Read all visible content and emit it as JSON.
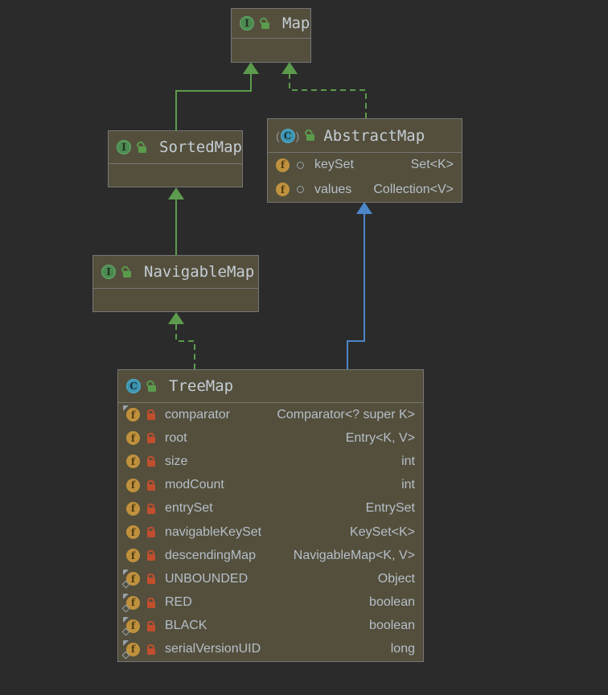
{
  "diagram": {
    "type": "uml-class-diagram",
    "colors": {
      "bg": "#2B2B2B",
      "box_fill": "#544F3C",
      "box_border": "#757575",
      "title": "#C4CDD5",
      "field": "#B5BFC9",
      "green": "#5C9B4D",
      "blue": "#4C87C9",
      "lock_private": "#C14E2E",
      "field_icon": "#C0913D",
      "mark": "#98A2AA"
    },
    "icons": {
      "interface_letter": "I",
      "class_letter": "C",
      "field_letter": "f",
      "abstract_paren_open": "(",
      "abstract_paren_close": ")"
    }
  },
  "classes": {
    "map": {
      "name": "Map",
      "kind": "interface",
      "visibility": "public",
      "fields": []
    },
    "sortedmap": {
      "name": "SortedMap",
      "kind": "interface",
      "visibility": "public",
      "fields": []
    },
    "abstractmap": {
      "name": "AbstractMap",
      "kind": "abstract-class",
      "visibility": "public",
      "fields": [
        {
          "name": "keySet",
          "type": "Set<K>",
          "visibility": "package"
        },
        {
          "name": "values",
          "type": "Collection<V>",
          "visibility": "package"
        }
      ]
    },
    "navigablemap": {
      "name": "NavigableMap",
      "kind": "interface",
      "visibility": "public",
      "fields": []
    },
    "treemap": {
      "name": "TreeMap",
      "kind": "class",
      "visibility": "public",
      "fields": [
        {
          "name": "comparator",
          "type": "Comparator<? super K>",
          "visibility": "private",
          "modifiers": [
            "final"
          ]
        },
        {
          "name": "root",
          "type": "Entry<K, V>",
          "visibility": "private",
          "modifiers": []
        },
        {
          "name": "size",
          "type": "int",
          "visibility": "private",
          "modifiers": []
        },
        {
          "name": "modCount",
          "type": "int",
          "visibility": "private",
          "modifiers": []
        },
        {
          "name": "entrySet",
          "type": "EntrySet",
          "visibility": "private",
          "modifiers": []
        },
        {
          "name": "navigableKeySet",
          "type": "KeySet<K>",
          "visibility": "private",
          "modifiers": []
        },
        {
          "name": "descendingMap",
          "type": "NavigableMap<K, V>",
          "visibility": "private",
          "modifiers": []
        },
        {
          "name": "UNBOUNDED",
          "type": "Object",
          "visibility": "private",
          "modifiers": [
            "static",
            "final"
          ]
        },
        {
          "name": "RED",
          "type": "boolean",
          "visibility": "private",
          "modifiers": [
            "static",
            "final"
          ]
        },
        {
          "name": "BLACK",
          "type": "boolean",
          "visibility": "private",
          "modifiers": [
            "static",
            "final"
          ]
        },
        {
          "name": "serialVersionUID",
          "type": "long",
          "visibility": "private",
          "modifiers": [
            "static",
            "final"
          ]
        }
      ]
    }
  },
  "edges": [
    {
      "from": "SortedMap",
      "to": "Map",
      "relation": "extends",
      "style": "solid",
      "color": "green"
    },
    {
      "from": "AbstractMap",
      "to": "Map",
      "relation": "implements",
      "style": "dashed",
      "color": "green"
    },
    {
      "from": "NavigableMap",
      "to": "SortedMap",
      "relation": "extends",
      "style": "solid",
      "color": "green"
    },
    {
      "from": "TreeMap",
      "to": "NavigableMap",
      "relation": "implements",
      "style": "dashed",
      "color": "green"
    },
    {
      "from": "TreeMap",
      "to": "AbstractMap",
      "relation": "extends",
      "style": "solid",
      "color": "blue"
    }
  ]
}
